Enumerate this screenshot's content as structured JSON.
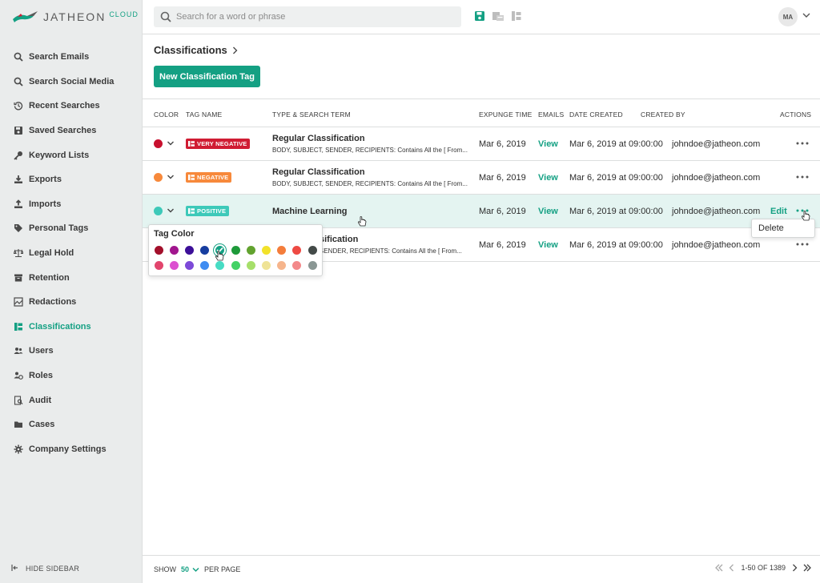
{
  "brand": {
    "name": "JATHEON",
    "suffix": "CLOUD"
  },
  "search": {
    "placeholder": "Search for a word or phrase"
  },
  "user": {
    "initials": "MA"
  },
  "sidebar": {
    "items": [
      {
        "label": "Search Emails",
        "icon": "search-icon"
      },
      {
        "label": "Search Social Media",
        "icon": "search-icon"
      },
      {
        "label": "Recent Searches",
        "icon": "history-icon"
      },
      {
        "label": "Saved Searches",
        "icon": "save-icon"
      },
      {
        "label": "Keyword Lists",
        "icon": "key-icon"
      },
      {
        "label": "Exports",
        "icon": "download-icon"
      },
      {
        "label": "Imports",
        "icon": "upload-icon"
      },
      {
        "label": "Personal Tags",
        "icon": "tag-icon"
      },
      {
        "label": "Legal Hold",
        "icon": "scale-icon"
      },
      {
        "label": "Retention",
        "icon": "archive-icon"
      },
      {
        "label": "Redactions",
        "icon": "redaction-icon"
      },
      {
        "label": "Classifications",
        "icon": "classification-icon",
        "active": true
      },
      {
        "label": "Users",
        "icon": "users-icon"
      },
      {
        "label": "Roles",
        "icon": "roles-icon"
      },
      {
        "label": "Audit",
        "icon": "audit-icon"
      },
      {
        "label": "Cases",
        "icon": "folder-icon"
      },
      {
        "label": "Company Settings",
        "icon": "gear-icon"
      }
    ],
    "hide_label": "HIDE SIDEBAR"
  },
  "page": {
    "breadcrumb": "Classifications",
    "new_button": "New Classification Tag"
  },
  "table": {
    "headers": {
      "color": "COLOR",
      "tag_name": "TAG NAME",
      "type": "TYPE & SEARCH TERM",
      "expunge": "EXPUNGE TIME",
      "emails": "EMAILS",
      "date_created": "DATE CREATED",
      "created_by": "CREATED BY",
      "actions": "ACTIONS"
    },
    "rows": [
      {
        "dot_color": "#c8102e",
        "tag": "VERY NEGATIVE",
        "tag_color": "#d01c33",
        "type": "Regular Classification",
        "term": "BODY, SUBJECT, SENDER, RECIPIENTS: Contains All the [ From...",
        "expunge": "Mar 6, 2019",
        "emails": "View",
        "date_created": "Mar 6, 2019 at 09:00:00",
        "created_by": "johndoe@jatheon.com"
      },
      {
        "dot_color": "#f7893b",
        "tag": "NEGATIVE",
        "tag_color": "#f7893b",
        "type": "Regular Classification",
        "term": "BODY, SUBJECT, SENDER, RECIPIENTS: Contains All the [ From...",
        "expunge": "Mar 6, 2019",
        "emails": "View",
        "date_created": "Mar 6, 2019 at 09:00:00",
        "created_by": "johndoe@jatheon.com"
      },
      {
        "dot_color": "#3dc9b9",
        "tag": "POSITIVE",
        "tag_color": "#3dc9b9",
        "type": "Machine Learning",
        "term": "",
        "expunge": "Mar 6, 2019",
        "emails": "View",
        "date_created": "Mar 6, 2019 at 09:00:00",
        "created_by": "johndoe@jatheon.com",
        "edit": "Edit"
      },
      {
        "dot_color": "#3dc9b9",
        "tag": "",
        "tag_color": "#3dc9b9",
        "type": "sification",
        "term": "SENDER, RECIPIENTS: Contains All the [ From...",
        "expunge": "Mar 6, 2019",
        "emails": "View",
        "date_created": "Mar 6, 2019 at 09:00:00",
        "created_by": "johndoe@jatheon.com"
      }
    ]
  },
  "color_picker": {
    "title": "Tag Color",
    "row1": [
      "#a3102b",
      "#a1168e",
      "#3c0f98",
      "#163d9f",
      "#14a083",
      "#1e9a3a",
      "#62a32f",
      "#f2e22a",
      "#f47d3b",
      "#ee4a43",
      "#434a48"
    ],
    "row2": [
      "#e2456d",
      "#dc50d0",
      "#7d4ad8",
      "#3f8cf1",
      "#47dcc4",
      "#43d266",
      "#a6df6a",
      "#efe396",
      "#f6b58c",
      "#f3898a",
      "#8a9794"
    ],
    "selected": "#14a083"
  },
  "context_menu": {
    "delete": "Delete"
  },
  "footer": {
    "show": "SHOW",
    "per_page_value": "50",
    "per_page": "PER PAGE",
    "range": "1-50 OF 1389"
  }
}
